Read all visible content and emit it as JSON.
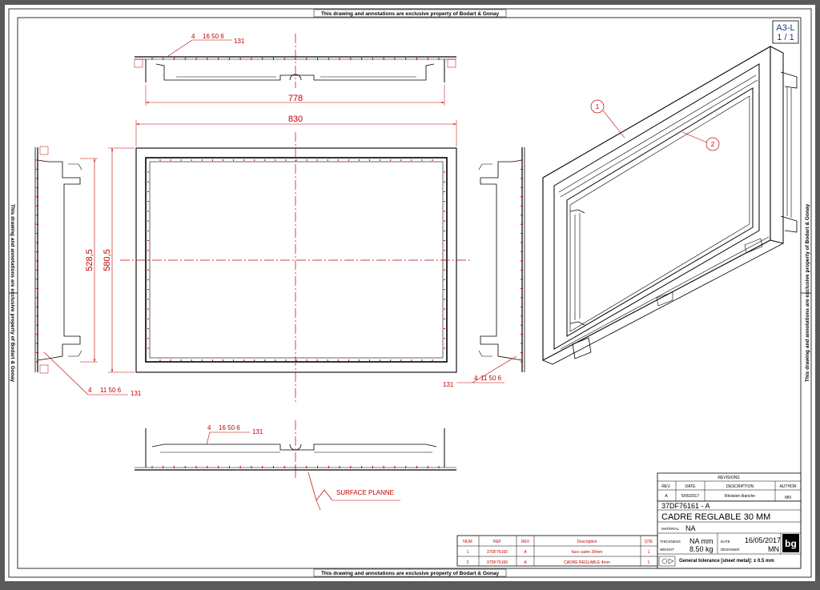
{
  "border_note": "This drawing and annotations are exclusive property of Bodart & Gonay",
  "sheet": {
    "format": "A3-L",
    "page": "1 / 1"
  },
  "dimensions": {
    "top_width": "778",
    "front_width": "830",
    "inner_height": "528,5",
    "outer_height": "580,5"
  },
  "welds": {
    "top": {
      "a": "4",
      "spec": "16  50 6",
      "ref": "131"
    },
    "left": {
      "a": "4",
      "spec": "11 50 6",
      "ref": "131"
    },
    "right": {
      "a": "4",
      "spec": "11 50 6",
      "ref": "131"
    },
    "bottom": {
      "a": "4",
      "spec": "16  50 6",
      "ref": "131"
    }
  },
  "surface_note": "SURFACE  PLANNE",
  "balloons": [
    "1",
    "2"
  ],
  "revisions": {
    "title": "REVISIONS",
    "headers": [
      "REV.",
      "DATE",
      "DESCRIPTION",
      "AUTHOR"
    ],
    "rows": [
      [
        "A",
        "5/05/2017",
        "Révision blanche",
        "MN"
      ]
    ]
  },
  "title_block": {
    "part_number": "37DF76161 - A",
    "title": "CADRE REGLABLE 30 MM",
    "material_label": "MATERIAL",
    "material": "NA",
    "thickness_label": "THICKNESS",
    "thickness": "NA mm",
    "weight_label": "WEIGHT",
    "weight": "8.50 kg",
    "date_label": "DATE",
    "date": "16/05/2017",
    "designer_label": "DESIGNER",
    "designer": "MN",
    "tolerance": "General tolerance [sheet metal]: ± 0.5 mm",
    "logo": "bg"
  },
  "bom": {
    "headers": [
      "NUM",
      "REF",
      "REV",
      "Description",
      "QTE"
    ],
    "rows": [
      [
        "1",
        "37DF76160",
        "A",
        "face cadre 30mm",
        "1"
      ],
      [
        "2",
        "37DF76160",
        "A",
        "CADRE REGLABLE 4mm",
        "1"
      ]
    ]
  }
}
